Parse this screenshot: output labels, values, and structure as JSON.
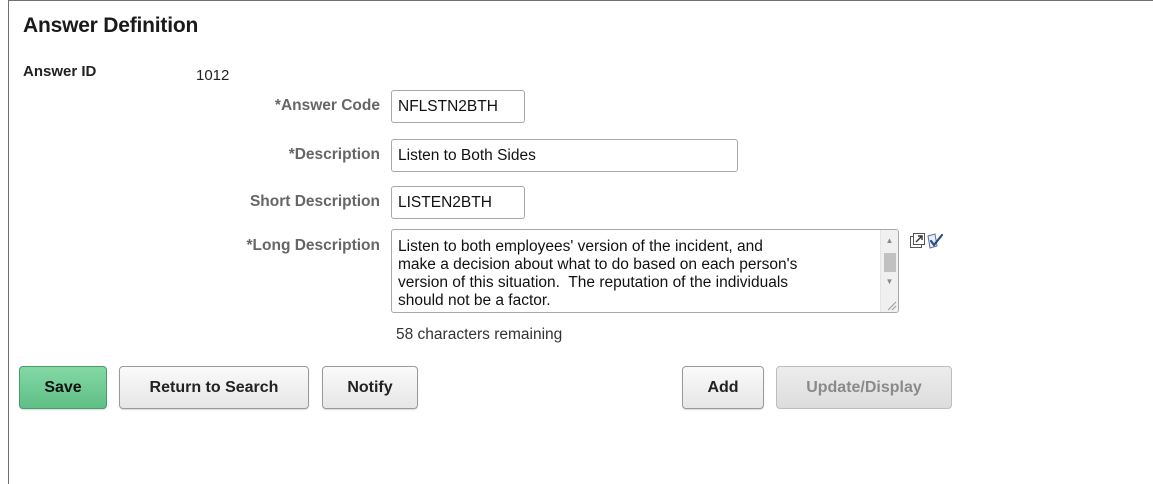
{
  "page": {
    "title": "Answer Definition"
  },
  "answer_id": {
    "label": "Answer ID",
    "value": "1012"
  },
  "fields": {
    "answer_code": {
      "label": "*Answer Code",
      "value": "NFLSTN2BTH"
    },
    "description": {
      "label": "*Description",
      "value": "Listen to Both Sides"
    },
    "short_description": {
      "label": "Short Description",
      "value": "LISTEN2BTH"
    },
    "long_description": {
      "label": "*Long Description",
      "value": "Listen to both employees' version of the incident, and\nmake a decision about what to do based on each person's\nversion of this situation.  The reputation of the individuals\nshould not be a factor.",
      "chars_remaining": "58 characters remaining"
    }
  },
  "buttons": {
    "save": "Save",
    "return_to_search": "Return to Search",
    "notify": "Notify",
    "add": "Add",
    "update_display": "Update/Display"
  },
  "icons": {
    "textarea_expand": "expand-window-icon",
    "spellcheck": "spellcheck-icon",
    "scroll_up": "scroll-up-arrow-icon",
    "scroll_down": "scroll-down-arrow-icon",
    "resize": "resize-grip-icon"
  },
  "colors": {
    "primary_button": "#6fcb93",
    "disabled_text": "#8a8a8a",
    "label_text": "#666666"
  }
}
